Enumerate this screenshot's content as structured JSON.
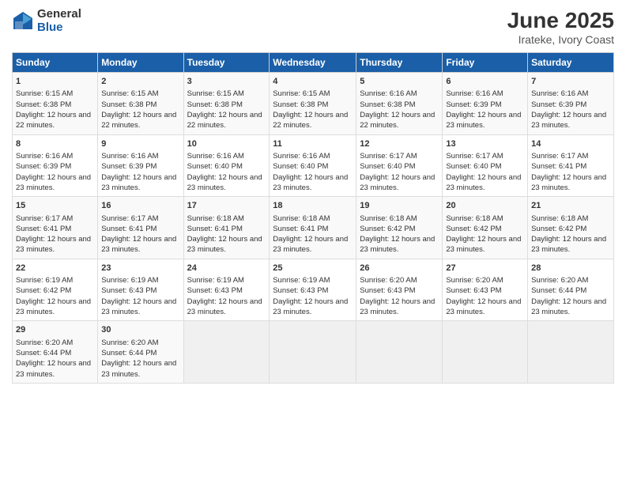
{
  "logo": {
    "general": "General",
    "blue": "Blue"
  },
  "title": "June 2025",
  "subtitle": "Irateke, Ivory Coast",
  "days_header": [
    "Sunday",
    "Monday",
    "Tuesday",
    "Wednesday",
    "Thursday",
    "Friday",
    "Saturday"
  ],
  "weeks": [
    [
      {
        "day": "1",
        "sunrise": "Sunrise: 6:15 AM",
        "sunset": "Sunset: 6:38 PM",
        "daylight": "Daylight: 12 hours and 22 minutes."
      },
      {
        "day": "2",
        "sunrise": "Sunrise: 6:15 AM",
        "sunset": "Sunset: 6:38 PM",
        "daylight": "Daylight: 12 hours and 22 minutes."
      },
      {
        "day": "3",
        "sunrise": "Sunrise: 6:15 AM",
        "sunset": "Sunset: 6:38 PM",
        "daylight": "Daylight: 12 hours and 22 minutes."
      },
      {
        "day": "4",
        "sunrise": "Sunrise: 6:15 AM",
        "sunset": "Sunset: 6:38 PM",
        "daylight": "Daylight: 12 hours and 22 minutes."
      },
      {
        "day": "5",
        "sunrise": "Sunrise: 6:16 AM",
        "sunset": "Sunset: 6:38 PM",
        "daylight": "Daylight: 12 hours and 22 minutes."
      },
      {
        "day": "6",
        "sunrise": "Sunrise: 6:16 AM",
        "sunset": "Sunset: 6:39 PM",
        "daylight": "Daylight: 12 hours and 23 minutes."
      },
      {
        "day": "7",
        "sunrise": "Sunrise: 6:16 AM",
        "sunset": "Sunset: 6:39 PM",
        "daylight": "Daylight: 12 hours and 23 minutes."
      }
    ],
    [
      {
        "day": "8",
        "sunrise": "Sunrise: 6:16 AM",
        "sunset": "Sunset: 6:39 PM",
        "daylight": "Daylight: 12 hours and 23 minutes."
      },
      {
        "day": "9",
        "sunrise": "Sunrise: 6:16 AM",
        "sunset": "Sunset: 6:39 PM",
        "daylight": "Daylight: 12 hours and 23 minutes."
      },
      {
        "day": "10",
        "sunrise": "Sunrise: 6:16 AM",
        "sunset": "Sunset: 6:40 PM",
        "daylight": "Daylight: 12 hours and 23 minutes."
      },
      {
        "day": "11",
        "sunrise": "Sunrise: 6:16 AM",
        "sunset": "Sunset: 6:40 PM",
        "daylight": "Daylight: 12 hours and 23 minutes."
      },
      {
        "day": "12",
        "sunrise": "Sunrise: 6:17 AM",
        "sunset": "Sunset: 6:40 PM",
        "daylight": "Daylight: 12 hours and 23 minutes."
      },
      {
        "day": "13",
        "sunrise": "Sunrise: 6:17 AM",
        "sunset": "Sunset: 6:40 PM",
        "daylight": "Daylight: 12 hours and 23 minutes."
      },
      {
        "day": "14",
        "sunrise": "Sunrise: 6:17 AM",
        "sunset": "Sunset: 6:41 PM",
        "daylight": "Daylight: 12 hours and 23 minutes."
      }
    ],
    [
      {
        "day": "15",
        "sunrise": "Sunrise: 6:17 AM",
        "sunset": "Sunset: 6:41 PM",
        "daylight": "Daylight: 12 hours and 23 minutes."
      },
      {
        "day": "16",
        "sunrise": "Sunrise: 6:17 AM",
        "sunset": "Sunset: 6:41 PM",
        "daylight": "Daylight: 12 hours and 23 minutes."
      },
      {
        "day": "17",
        "sunrise": "Sunrise: 6:18 AM",
        "sunset": "Sunset: 6:41 PM",
        "daylight": "Daylight: 12 hours and 23 minutes."
      },
      {
        "day": "18",
        "sunrise": "Sunrise: 6:18 AM",
        "sunset": "Sunset: 6:41 PM",
        "daylight": "Daylight: 12 hours and 23 minutes."
      },
      {
        "day": "19",
        "sunrise": "Sunrise: 6:18 AM",
        "sunset": "Sunset: 6:42 PM",
        "daylight": "Daylight: 12 hours and 23 minutes."
      },
      {
        "day": "20",
        "sunrise": "Sunrise: 6:18 AM",
        "sunset": "Sunset: 6:42 PM",
        "daylight": "Daylight: 12 hours and 23 minutes."
      },
      {
        "day": "21",
        "sunrise": "Sunrise: 6:18 AM",
        "sunset": "Sunset: 6:42 PM",
        "daylight": "Daylight: 12 hours and 23 minutes."
      }
    ],
    [
      {
        "day": "22",
        "sunrise": "Sunrise: 6:19 AM",
        "sunset": "Sunset: 6:42 PM",
        "daylight": "Daylight: 12 hours and 23 minutes."
      },
      {
        "day": "23",
        "sunrise": "Sunrise: 6:19 AM",
        "sunset": "Sunset: 6:43 PM",
        "daylight": "Daylight: 12 hours and 23 minutes."
      },
      {
        "day": "24",
        "sunrise": "Sunrise: 6:19 AM",
        "sunset": "Sunset: 6:43 PM",
        "daylight": "Daylight: 12 hours and 23 minutes."
      },
      {
        "day": "25",
        "sunrise": "Sunrise: 6:19 AM",
        "sunset": "Sunset: 6:43 PM",
        "daylight": "Daylight: 12 hours and 23 minutes."
      },
      {
        "day": "26",
        "sunrise": "Sunrise: 6:20 AM",
        "sunset": "Sunset: 6:43 PM",
        "daylight": "Daylight: 12 hours and 23 minutes."
      },
      {
        "day": "27",
        "sunrise": "Sunrise: 6:20 AM",
        "sunset": "Sunset: 6:43 PM",
        "daylight": "Daylight: 12 hours and 23 minutes."
      },
      {
        "day": "28",
        "sunrise": "Sunrise: 6:20 AM",
        "sunset": "Sunset: 6:44 PM",
        "daylight": "Daylight: 12 hours and 23 minutes."
      }
    ],
    [
      {
        "day": "29",
        "sunrise": "Sunrise: 6:20 AM",
        "sunset": "Sunset: 6:44 PM",
        "daylight": "Daylight: 12 hours and 23 minutes."
      },
      {
        "day": "30",
        "sunrise": "Sunrise: 6:20 AM",
        "sunset": "Sunset: 6:44 PM",
        "daylight": "Daylight: 12 hours and 23 minutes."
      },
      null,
      null,
      null,
      null,
      null
    ]
  ]
}
